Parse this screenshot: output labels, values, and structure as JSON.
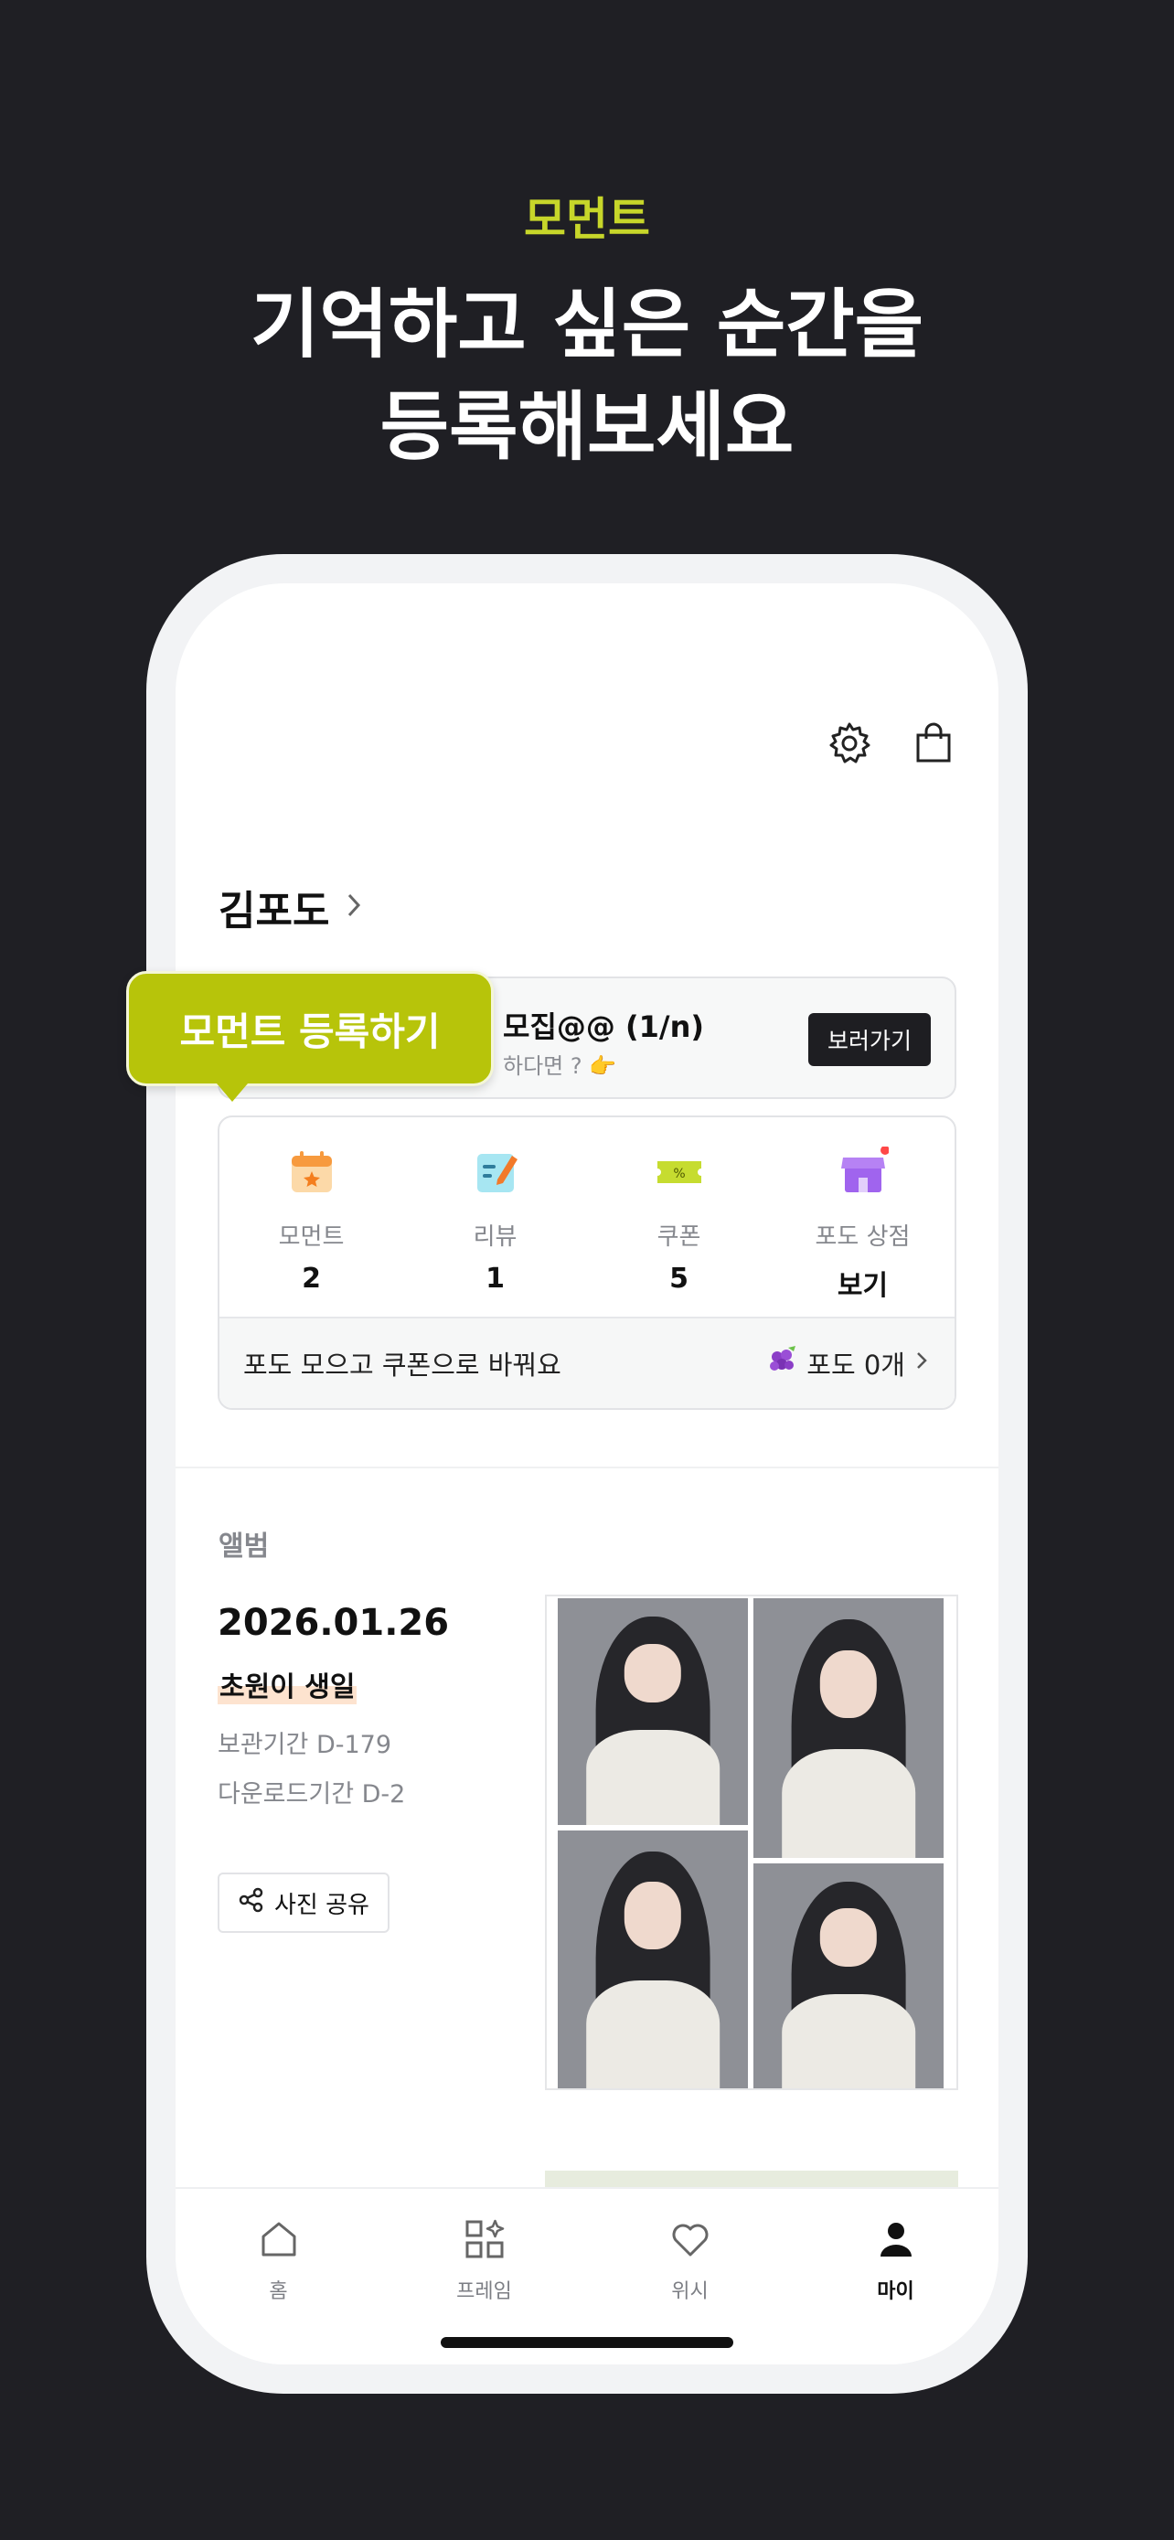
{
  "promo": {
    "subtitle": "모먼트",
    "title_line1": "기억하고 싶은 순간을",
    "title_line2": "등록해보세요"
  },
  "header": {
    "settings_icon": "gear-icon",
    "cart_icon": "shopping-bag-icon"
  },
  "profile": {
    "name": "김포도"
  },
  "banner": {
    "title": "모집@@ (1/n)",
    "subtitle": "하다면 ? 👉",
    "button": "보러가기"
  },
  "tooltip": {
    "text": "모먼트 등록하기"
  },
  "stats": [
    {
      "label": "모먼트",
      "value": "2",
      "icon": "calendar-icon",
      "color": "#f7a64a"
    },
    {
      "label": "리뷰",
      "value": "1",
      "icon": "review-note-icon",
      "color": "#6fd0e8"
    },
    {
      "label": "쿠폰",
      "value": "5",
      "icon": "coupon-icon",
      "color": "#c4dc2c"
    },
    {
      "label": "포도 상점",
      "value": "보기",
      "icon": "store-icon",
      "color": "#a66af0"
    }
  ],
  "grape_bar": {
    "text": "포도 모으고 쿠폰으로 바꿔요",
    "count_label": "포도 0개"
  },
  "album": {
    "heading": "앨범",
    "date": "2026.01.26",
    "title": "초원이 생일",
    "keep_period": "보관기간 D-179",
    "download_period": "다운로드기간 D-2",
    "share_button": "사진 공유"
  },
  "tabs": [
    {
      "label": "홈",
      "icon": "home-icon",
      "active": false
    },
    {
      "label": "프레임",
      "icon": "frame-grid-icon",
      "active": false
    },
    {
      "label": "위시",
      "icon": "heart-icon",
      "active": false
    },
    {
      "label": "마이",
      "icon": "person-icon",
      "active": true
    }
  ]
}
